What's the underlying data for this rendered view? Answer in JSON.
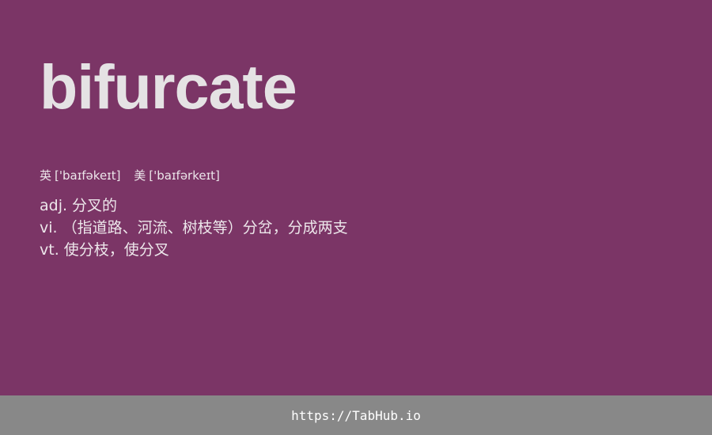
{
  "colors": {
    "background": "#7b3566",
    "text": "#e5e2e4",
    "footer_background": "#888888",
    "footer_text": "#ffffff"
  },
  "word": "bifurcate",
  "phonetics": {
    "uk_label": "英",
    "uk": "['baɪfəkeɪt]",
    "us_label": "美",
    "us": "['baɪfərkeɪt]"
  },
  "definitions": [
    {
      "pos": "adj.",
      "meaning": "分叉的"
    },
    {
      "pos": "vi.",
      "meaning": "（指道路、河流、树枝等）分岔，分成两支"
    },
    {
      "pos": "vt.",
      "meaning": "使分枝，使分叉"
    }
  ],
  "footer": {
    "link_text": "https://TabHub.io"
  }
}
